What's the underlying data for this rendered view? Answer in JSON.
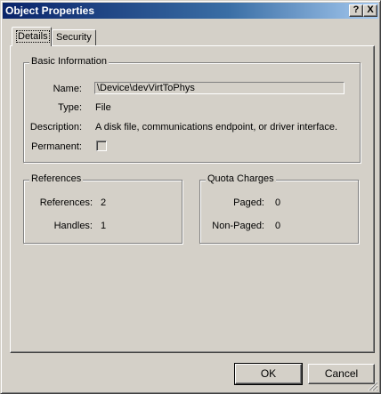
{
  "window": {
    "title": "Object Properties"
  },
  "titlebar": {
    "help_glyph": "?",
    "close_glyph": "X"
  },
  "tabs": [
    {
      "label": "Details",
      "selected": true
    },
    {
      "label": "Security",
      "selected": false
    }
  ],
  "basic_info": {
    "title": "Basic Information",
    "name_label": "Name:",
    "name_value": "\\Device\\devVirtToPhys",
    "type_label": "Type:",
    "type_value": "File",
    "description_label": "Description:",
    "description_value": "A disk file, communications endpoint, or driver interface.",
    "permanent_label": "Permanent:",
    "permanent_checked": false
  },
  "references": {
    "title": "References",
    "references_label": "References:",
    "references_value": "2",
    "handles_label": "Handles:",
    "handles_value": "1"
  },
  "quota": {
    "title": "Quota Charges",
    "paged_label": "Paged:",
    "paged_value": "0",
    "nonpaged_label": "Non-Paged:",
    "nonpaged_value": "0"
  },
  "buttons": {
    "ok": "OK",
    "cancel": "Cancel"
  },
  "colors": {
    "title_active": "#0a246a",
    "face": "#d4d0c8",
    "shadow": "#808080",
    "highlight": "#ffffff"
  }
}
